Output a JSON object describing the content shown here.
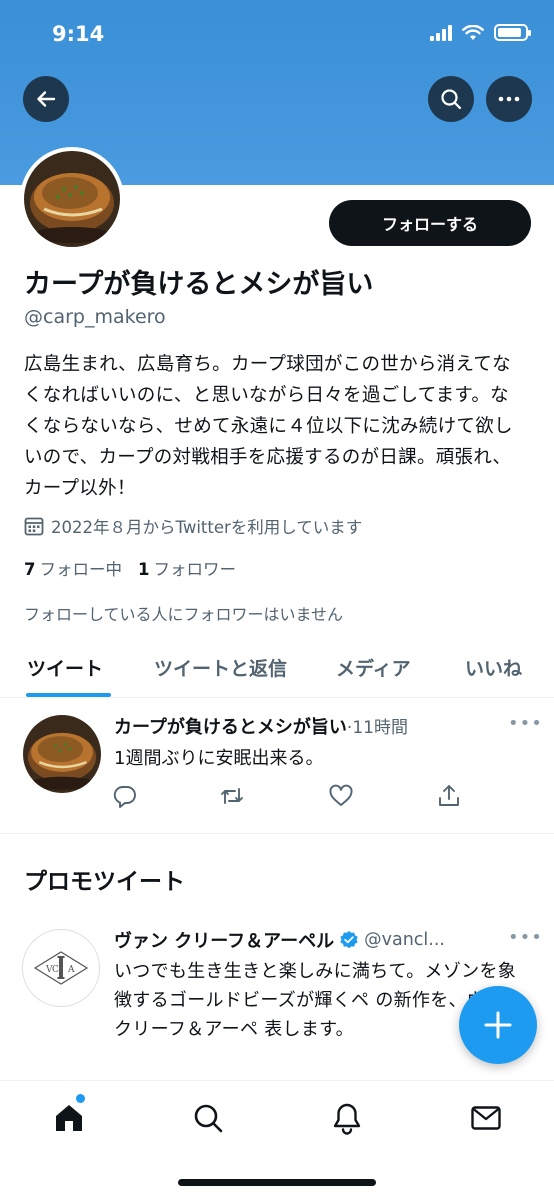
{
  "status_bar": {
    "time": "9:14",
    "battery_level": 0.9
  },
  "header": {
    "back_icon": "arrow-left-icon",
    "search_icon": "search-icon",
    "more_icon": "more-horizontal-icon",
    "banner_color": "#3a8fd6"
  },
  "profile": {
    "follow_label": "フォローする",
    "display_name": "カープが負けるとメシが旨い",
    "handle": "@carp_makero",
    "bio": "広島生まれ、広島育ち。カープ球団がこの世から消えてなくなればいいのに、と思いながら日々を過ごしてます。なくならないなら、せめて永遠に４位以下に沈み続けて欲しいので、カープの対戦相手を応援するのが日課。頑張れ、カープ以外！",
    "joined": "2022年８月からTwitterを利用しています",
    "following_count": "7",
    "following_label": "フォロー中",
    "followers_count": "1",
    "followers_label": "フォロワー",
    "followers_note": "フォローしている人にフォロワーはいません"
  },
  "tabs": [
    {
      "label": "ツイート",
      "active": true
    },
    {
      "label": "ツイートと返信",
      "active": false
    },
    {
      "label": "メディア",
      "active": false
    },
    {
      "label": "いいね",
      "active": false
    }
  ],
  "tweet": {
    "name": "カープが負けるとメシが旨い",
    "separator": "·",
    "time": "11時間",
    "more": "•••",
    "text": "1週間ぶりに安眠出来る。"
  },
  "promoted": {
    "section_title": "プロモツイート",
    "name": "ヴァン クリーフ＆アーペル",
    "handle": "@vancl...",
    "more": "•••",
    "avatar_logo_text": "VCA",
    "text": "いつでも生き生きと楽しみに満ちて。メゾンを象徴するゴールドビーズが輝くペ の新作を、ヴァン クリーフ＆アーペ 表します。"
  },
  "colors": {
    "accent": "#1d9bf0",
    "text": "#0f1419",
    "secondary": "#536471"
  }
}
